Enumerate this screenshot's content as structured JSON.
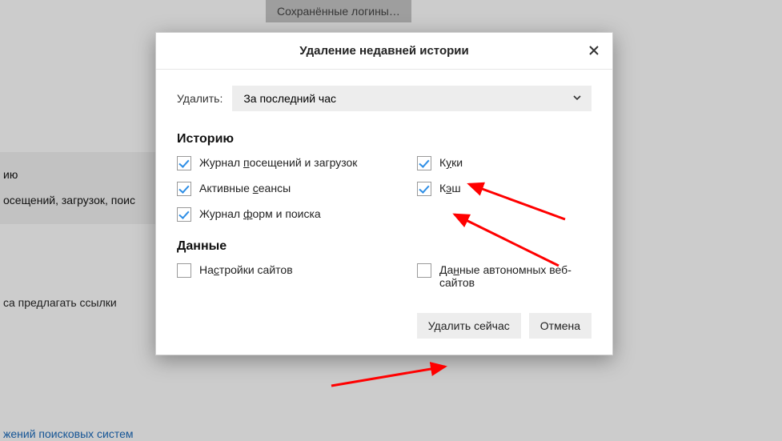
{
  "background": {
    "saved_logins_button": "Сохранённые логины…",
    "left_panel": {
      "row1": "ию",
      "row2": "осещений, загрузок, поис"
    },
    "suggest_links": "са предлагать ссылки",
    "search_engines_link": "жений поисковых систем"
  },
  "dialog": {
    "title": "Удаление недавней истории",
    "range_label": "Удалить:",
    "range_value": "За последний час",
    "history_section": "Историю",
    "data_section": "Данные",
    "checkboxes": {
      "browsing": {
        "label_pre": "Журнал ",
        "u": "п",
        "label_post": "осещений и загрузок",
        "checked": true
      },
      "cookies": {
        "label_pre": "К",
        "u": "у",
        "label_post": "ки",
        "checked": true
      },
      "sessions": {
        "label_pre": "Активные ",
        "u": "с",
        "label_post": "еансы",
        "checked": true
      },
      "cache": {
        "label_pre": "К",
        "u": "э",
        "label_post": "ш",
        "checked": true
      },
      "forms": {
        "label_pre": "Журнал ",
        "u": "ф",
        "label_post": "орм и поиска",
        "checked": true
      },
      "siteprefs": {
        "label_pre": "На",
        "u": "с",
        "label_post": "тройки сайтов",
        "checked": false
      },
      "offline": {
        "label_pre": "Да",
        "u": "н",
        "label_post": "ные автономных веб-сайтов",
        "checked": false
      }
    },
    "buttons": {
      "clear_now": "Удалить сейчас",
      "cancel": "Отмена"
    }
  }
}
